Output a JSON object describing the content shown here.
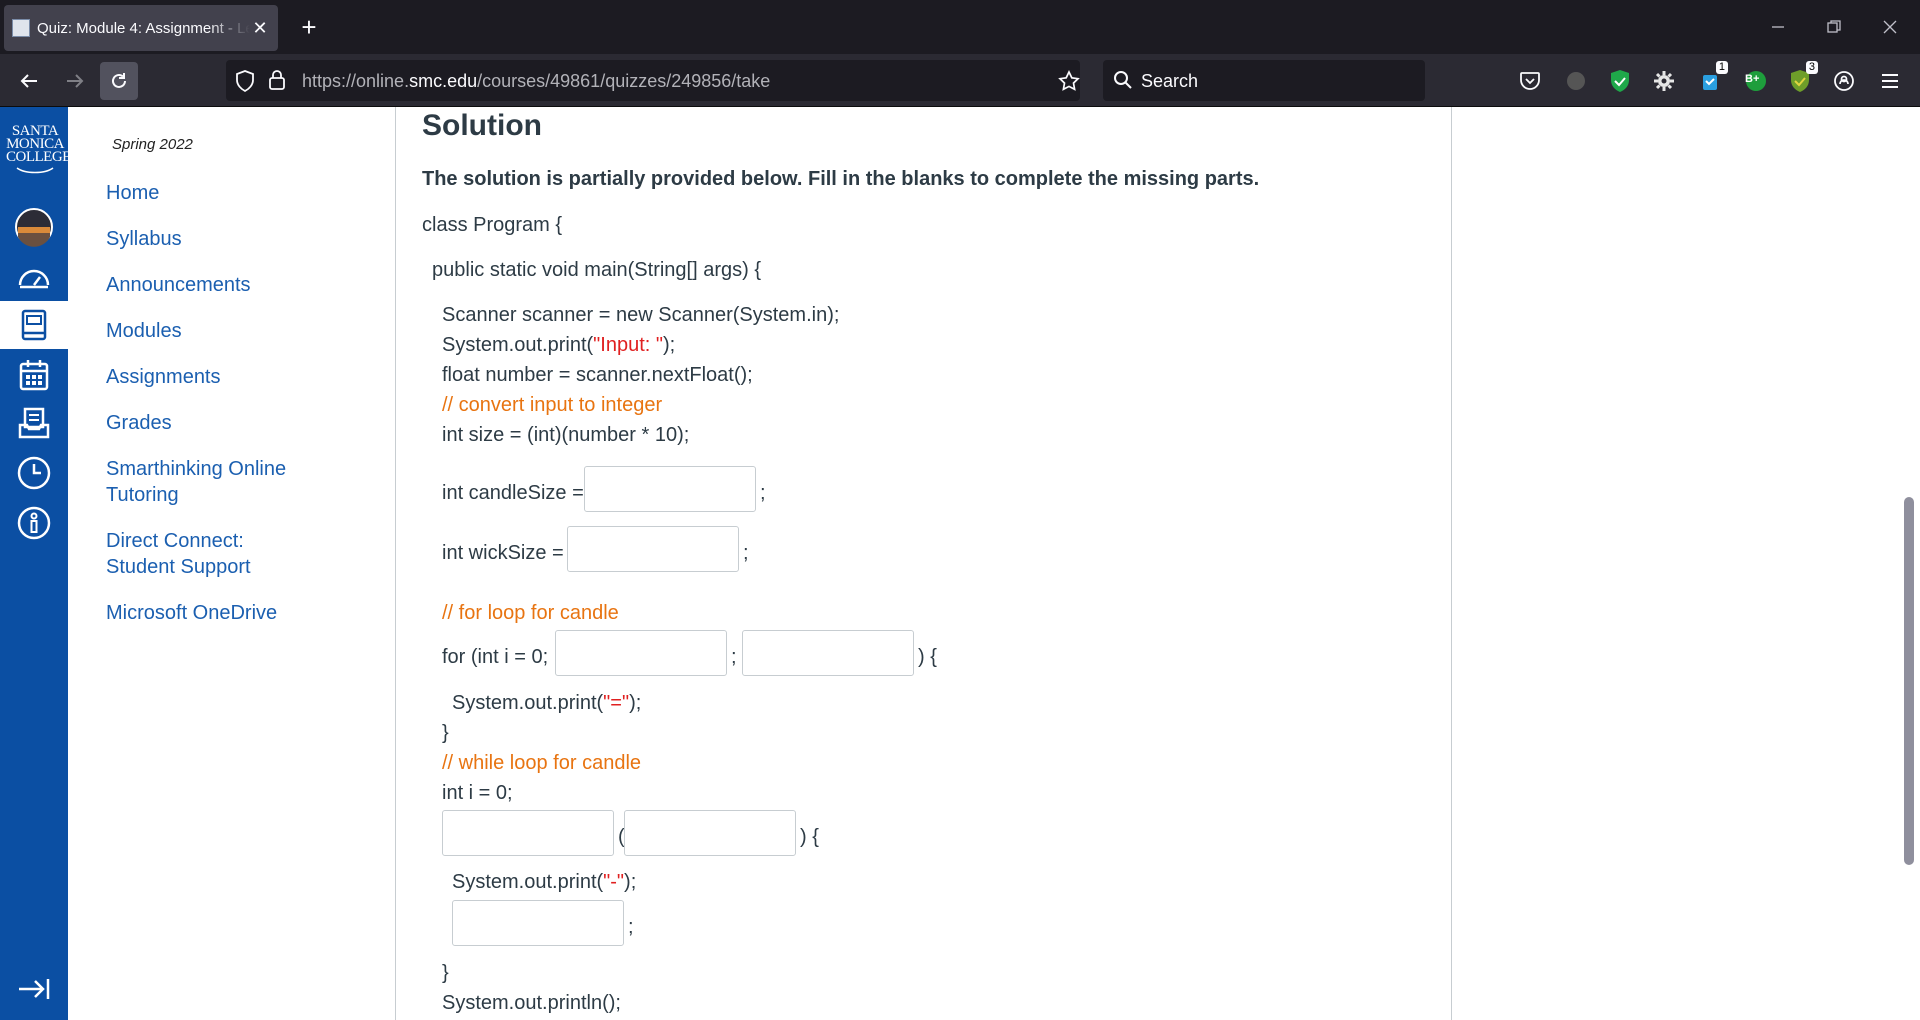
{
  "browser": {
    "tab_title": "Quiz: Module 4: Assignment - Le",
    "new_tab_label": "+",
    "url_plain_prefix": "https://online.",
    "url_domain": "smc.edu",
    "url_path": "/courses/49861/quizzes/249856/take",
    "search_placeholder": "Search",
    "extension_badges": {
      "ext1": "1",
      "ext2": "B+",
      "ext3": "3"
    }
  },
  "global_nav": {
    "logo_lines": [
      "SANTA",
      "MONICA",
      "COLLEGE"
    ]
  },
  "course_nav": {
    "term": "Spring 2022",
    "links": [
      "Home",
      "Syllabus",
      "Announcements",
      "Modules",
      "Assignments",
      "Grades",
      "Smarthinking Online Tutoring",
      "Direct Connect: Student Support",
      "Microsoft OneDrive"
    ]
  },
  "quiz": {
    "heading": "Solution",
    "instructions": "The solution is partially provided below. Fill in the blanks to complete the missing parts.",
    "code": {
      "class_decl": "class Program {",
      "main_decl": "public static void main(String[] args) {",
      "scanner_line": "Scanner scanner = new Scanner(System.in);",
      "print_input_pre": "System.out.print(",
      "print_input_str": "\"Input: \"",
      "print_input_post": ");",
      "float_line": "float number = scanner.nextFloat();",
      "comment_convert": "// convert input to integer",
      "size_line": "int size = (int)(number * 10);",
      "candle_size_label": "int candleSize =",
      "wick_size_label": "int wickSize =",
      "semicolon": ";",
      "comment_for": "// for loop for candle",
      "for_label": "for (int i = 0;",
      "for_close": ") {",
      "print_eq_pre": "System.out.print(",
      "print_eq_str": "\"=\"",
      "print_eq_post": ");",
      "close_brace": "}",
      "comment_while": "// while loop for candle",
      "int_i_line": "int i = 0;",
      "open_paren": "(",
      "while_close": ") {",
      "print_dash_pre": "System.out.print(",
      "print_dash_str": "\"-\"",
      "print_dash_post": ");",
      "println_line": "System.out.println();"
    },
    "blanks": {
      "candle_size": "",
      "wick_size": "",
      "for_condition": "",
      "for_update": "",
      "while_keyword": "",
      "while_condition": "",
      "while_body": ""
    }
  },
  "colors": {
    "global_nav_bg": "#0b4fa3",
    "link": "#1b5fb0",
    "string_literal": "#e02020",
    "comment": "#e87411"
  }
}
